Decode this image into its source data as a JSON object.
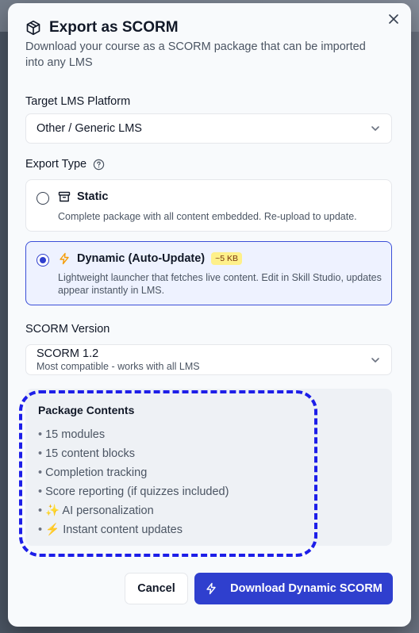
{
  "dialog": {
    "title": "Export as SCORM",
    "subtitle": "Download your course as a SCORM package that can be imported into any LMS"
  },
  "lms": {
    "label": "Target LMS Platform",
    "selected": "Other / Generic LMS"
  },
  "export_type": {
    "label": "Export Type",
    "options": [
      {
        "title": "Static",
        "description": "Complete package with all content embedded. Re-upload to update.",
        "icon": "archive-icon",
        "selected": false
      },
      {
        "title": "Dynamic (Auto-Update)",
        "badge": "~5 KB",
        "description": "Lightweight launcher that fetches live content. Edit in Skill Studio, updates appear instantly in LMS.",
        "icon": "lightning-icon",
        "selected": true
      }
    ]
  },
  "scorm_version": {
    "label": "SCORM Version",
    "selected": "SCORM 1.2",
    "hint": "Most compatible - works with all LMS"
  },
  "package_contents": {
    "title": "Package Contents",
    "items": [
      "15 modules",
      "15 content blocks",
      "Completion tracking",
      "Score reporting (if quizzes included)",
      "✨ AI personalization",
      "⚡ Instant content updates"
    ]
  },
  "actions": {
    "cancel": "Cancel",
    "download": "Download Dynamic SCORM"
  },
  "colors": {
    "accent": "#2f3fce",
    "badge_bg": "#fef08a",
    "annotation": "#1d1ee8"
  }
}
